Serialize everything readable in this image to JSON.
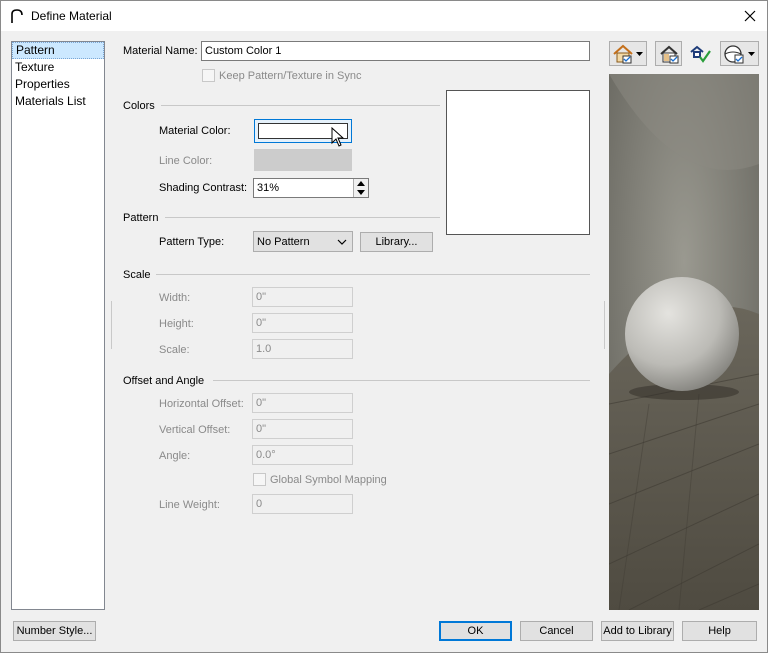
{
  "window": {
    "title": "Define Material",
    "close_label": "✕"
  },
  "sidebar": {
    "items": [
      {
        "label": "Pattern",
        "selected": true
      },
      {
        "label": "Texture",
        "selected": false
      },
      {
        "label": "Properties",
        "selected": false
      },
      {
        "label": "Materials List",
        "selected": false
      }
    ]
  },
  "material_name": {
    "label": "Material Name:",
    "value": "Custom Color 1"
  },
  "keep_sync": {
    "label": "Keep Pattern/Texture in Sync",
    "checked": false,
    "enabled": false
  },
  "colors": {
    "title": "Colors",
    "material_color_label": "Material Color:",
    "material_color_value": "#ffffff",
    "line_color_label": "Line Color:",
    "shading_contrast_label": "Shading Contrast:",
    "shading_contrast_value": "31%"
  },
  "pattern": {
    "title": "Pattern",
    "type_label": "Pattern Type:",
    "type_value": "No Pattern",
    "library_button": "Library..."
  },
  "scale": {
    "title": "Scale",
    "width_label": "Width:",
    "width_value": "0\"",
    "height_label": "Height:",
    "height_value": "0\"",
    "scale_label": "Scale:",
    "scale_value": "1.0"
  },
  "offset_angle": {
    "title": "Offset and Angle",
    "horizontal_label": "Horizontal Offset:",
    "horizontal_value": "0\"",
    "vertical_label": "Vertical Offset:",
    "vertical_value": "0\"",
    "angle_label": "Angle:",
    "angle_value": "0.0°",
    "global_mapping_label": "Global Symbol Mapping",
    "line_weight_label": "Line Weight:",
    "line_weight_value": "0"
  },
  "toolbar": {
    "icons": [
      "house-view-icon",
      "house-check-icon",
      "render-check-icon",
      "sphere-view-icon"
    ]
  },
  "footer": {
    "number_style": "Number Style...",
    "ok": "OK",
    "cancel": "Cancel",
    "add_to_library": "Add to Library",
    "help": "Help"
  },
  "colors_theme": {
    "accent": "#0078d7",
    "selection": "#cce8ff"
  }
}
